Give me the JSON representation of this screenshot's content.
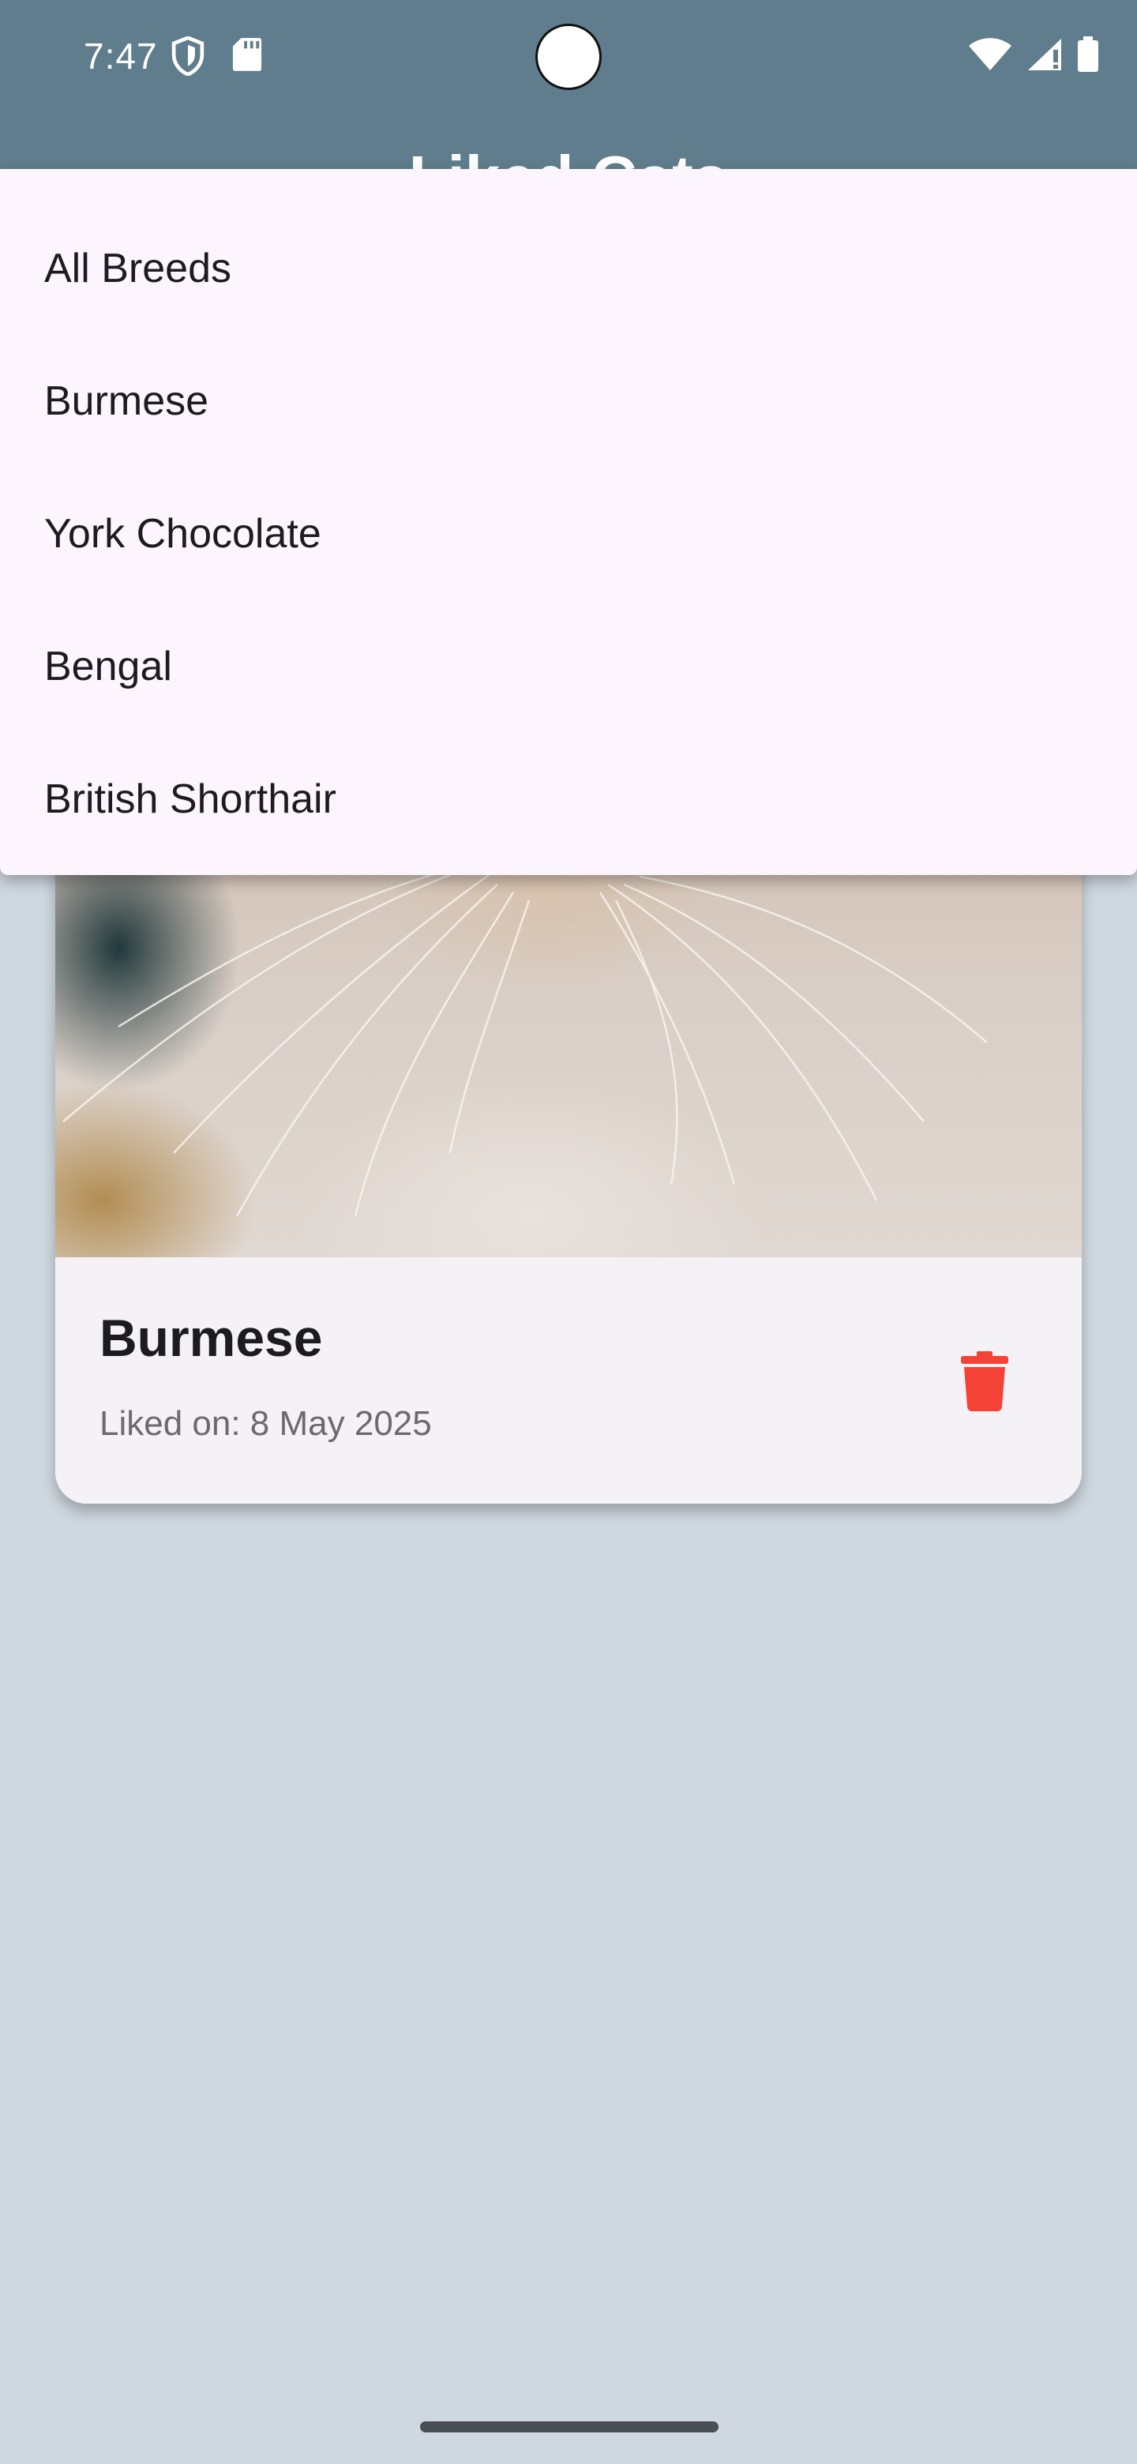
{
  "status_bar": {
    "time": "7:47",
    "left_icons": [
      "shield-icon",
      "sd-card-icon"
    ],
    "right_icons": [
      "wifi-icon",
      "cellular-signal-icon",
      "battery-icon"
    ]
  },
  "app_bar": {
    "title": "Liked Cats",
    "background_color": "#5f7d8c"
  },
  "breed_filter_menu": {
    "options": [
      "All Breeds",
      "Burmese",
      "York Chocolate",
      "Bengal",
      "British Shorthair"
    ]
  },
  "liked_cats": [
    {
      "breed": "Burmese",
      "liked_on": "Liked on: 8 May 2025",
      "delete_icon": "trash-icon",
      "delete_color": "#f44336"
    }
  ]
}
